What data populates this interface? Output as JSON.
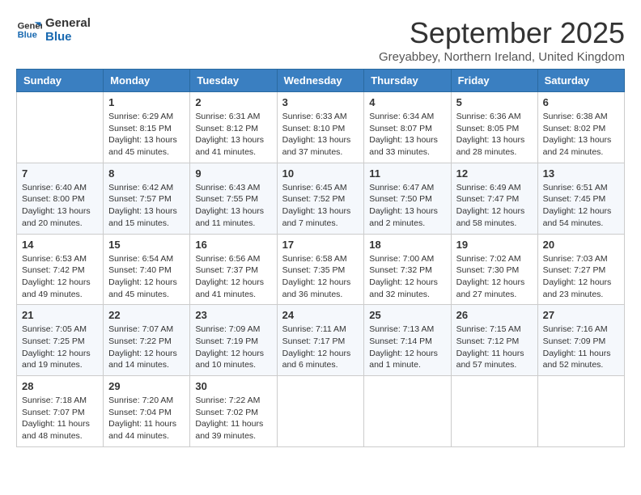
{
  "logo": {
    "line1": "General",
    "line2": "Blue"
  },
  "title": "September 2025",
  "location": "Greyabbey, Northern Ireland, United Kingdom",
  "weekdays": [
    "Sunday",
    "Monday",
    "Tuesday",
    "Wednesday",
    "Thursday",
    "Friday",
    "Saturday"
  ],
  "weeks": [
    [
      {
        "day": "",
        "info": ""
      },
      {
        "day": "1",
        "info": "Sunrise: 6:29 AM\nSunset: 8:15 PM\nDaylight: 13 hours\nand 45 minutes."
      },
      {
        "day": "2",
        "info": "Sunrise: 6:31 AM\nSunset: 8:12 PM\nDaylight: 13 hours\nand 41 minutes."
      },
      {
        "day": "3",
        "info": "Sunrise: 6:33 AM\nSunset: 8:10 PM\nDaylight: 13 hours\nand 37 minutes."
      },
      {
        "day": "4",
        "info": "Sunrise: 6:34 AM\nSunset: 8:07 PM\nDaylight: 13 hours\nand 33 minutes."
      },
      {
        "day": "5",
        "info": "Sunrise: 6:36 AM\nSunset: 8:05 PM\nDaylight: 13 hours\nand 28 minutes."
      },
      {
        "day": "6",
        "info": "Sunrise: 6:38 AM\nSunset: 8:02 PM\nDaylight: 13 hours\nand 24 minutes."
      }
    ],
    [
      {
        "day": "7",
        "info": "Sunrise: 6:40 AM\nSunset: 8:00 PM\nDaylight: 13 hours\nand 20 minutes."
      },
      {
        "day": "8",
        "info": "Sunrise: 6:42 AM\nSunset: 7:57 PM\nDaylight: 13 hours\nand 15 minutes."
      },
      {
        "day": "9",
        "info": "Sunrise: 6:43 AM\nSunset: 7:55 PM\nDaylight: 13 hours\nand 11 minutes."
      },
      {
        "day": "10",
        "info": "Sunrise: 6:45 AM\nSunset: 7:52 PM\nDaylight: 13 hours\nand 7 minutes."
      },
      {
        "day": "11",
        "info": "Sunrise: 6:47 AM\nSunset: 7:50 PM\nDaylight: 13 hours\nand 2 minutes."
      },
      {
        "day": "12",
        "info": "Sunrise: 6:49 AM\nSunset: 7:47 PM\nDaylight: 12 hours\nand 58 minutes."
      },
      {
        "day": "13",
        "info": "Sunrise: 6:51 AM\nSunset: 7:45 PM\nDaylight: 12 hours\nand 54 minutes."
      }
    ],
    [
      {
        "day": "14",
        "info": "Sunrise: 6:53 AM\nSunset: 7:42 PM\nDaylight: 12 hours\nand 49 minutes."
      },
      {
        "day": "15",
        "info": "Sunrise: 6:54 AM\nSunset: 7:40 PM\nDaylight: 12 hours\nand 45 minutes."
      },
      {
        "day": "16",
        "info": "Sunrise: 6:56 AM\nSunset: 7:37 PM\nDaylight: 12 hours\nand 41 minutes."
      },
      {
        "day": "17",
        "info": "Sunrise: 6:58 AM\nSunset: 7:35 PM\nDaylight: 12 hours\nand 36 minutes."
      },
      {
        "day": "18",
        "info": "Sunrise: 7:00 AM\nSunset: 7:32 PM\nDaylight: 12 hours\nand 32 minutes."
      },
      {
        "day": "19",
        "info": "Sunrise: 7:02 AM\nSunset: 7:30 PM\nDaylight: 12 hours\nand 27 minutes."
      },
      {
        "day": "20",
        "info": "Sunrise: 7:03 AM\nSunset: 7:27 PM\nDaylight: 12 hours\nand 23 minutes."
      }
    ],
    [
      {
        "day": "21",
        "info": "Sunrise: 7:05 AM\nSunset: 7:25 PM\nDaylight: 12 hours\nand 19 minutes."
      },
      {
        "day": "22",
        "info": "Sunrise: 7:07 AM\nSunset: 7:22 PM\nDaylight: 12 hours\nand 14 minutes."
      },
      {
        "day": "23",
        "info": "Sunrise: 7:09 AM\nSunset: 7:19 PM\nDaylight: 12 hours\nand 10 minutes."
      },
      {
        "day": "24",
        "info": "Sunrise: 7:11 AM\nSunset: 7:17 PM\nDaylight: 12 hours\nand 6 minutes."
      },
      {
        "day": "25",
        "info": "Sunrise: 7:13 AM\nSunset: 7:14 PM\nDaylight: 12 hours\nand 1 minute."
      },
      {
        "day": "26",
        "info": "Sunrise: 7:15 AM\nSunset: 7:12 PM\nDaylight: 11 hours\nand 57 minutes."
      },
      {
        "day": "27",
        "info": "Sunrise: 7:16 AM\nSunset: 7:09 PM\nDaylight: 11 hours\nand 52 minutes."
      }
    ],
    [
      {
        "day": "28",
        "info": "Sunrise: 7:18 AM\nSunset: 7:07 PM\nDaylight: 11 hours\nand 48 minutes."
      },
      {
        "day": "29",
        "info": "Sunrise: 7:20 AM\nSunset: 7:04 PM\nDaylight: 11 hours\nand 44 minutes."
      },
      {
        "day": "30",
        "info": "Sunrise: 7:22 AM\nSunset: 7:02 PM\nDaylight: 11 hours\nand 39 minutes."
      },
      {
        "day": "",
        "info": ""
      },
      {
        "day": "",
        "info": ""
      },
      {
        "day": "",
        "info": ""
      },
      {
        "day": "",
        "info": ""
      }
    ]
  ]
}
